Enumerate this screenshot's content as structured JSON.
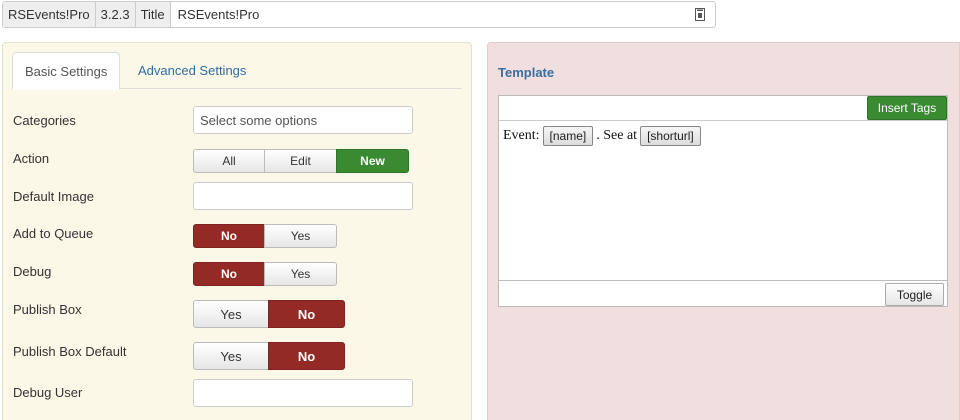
{
  "infobar": {
    "component": "RSEvents!Pro",
    "version": "3.2.3",
    "title_label": "Title",
    "title_value": "RSEvents!Pro",
    "icon": "calendar-icon"
  },
  "tabs": [
    {
      "label": "Basic Settings",
      "active": true
    },
    {
      "label": "Advanced Settings",
      "active": false
    }
  ],
  "settings": {
    "categories": {
      "label": "Categories",
      "placeholder": "Select some options"
    },
    "action": {
      "label": "Action",
      "options": [
        "All",
        "Edit",
        "New"
      ],
      "selected": "New"
    },
    "default_image": {
      "label": "Default Image",
      "value": ""
    },
    "add_to_queue": {
      "label": "Add to Queue",
      "options": [
        "No",
        "Yes"
      ],
      "selected": "No"
    },
    "debug": {
      "label": "Debug",
      "options": [
        "No",
        "Yes"
      ],
      "selected": "No"
    },
    "publish_box": {
      "label": "Publish Box",
      "options": [
        "Yes",
        "No"
      ],
      "selected": "No"
    },
    "publish_box_default": {
      "label": "Publish Box Default",
      "options": [
        "Yes",
        "No"
      ],
      "selected": "No"
    },
    "debug_user": {
      "label": "Debug User",
      "value": ""
    }
  },
  "template": {
    "title": "Template",
    "insert_tags_label": "Insert Tags",
    "content": {
      "prefix": "Event:",
      "tag1": "[name]",
      "middle": ". See at",
      "tag2": "[shorturl]"
    },
    "toggle_label": "Toggle"
  },
  "colors": {
    "selected_red": "#942a25",
    "selected_green": "#3a8a32",
    "left_panel_bg": "#fcf8e7",
    "right_panel_bg": "#f1dede",
    "link_blue": "#2f6ca5"
  }
}
